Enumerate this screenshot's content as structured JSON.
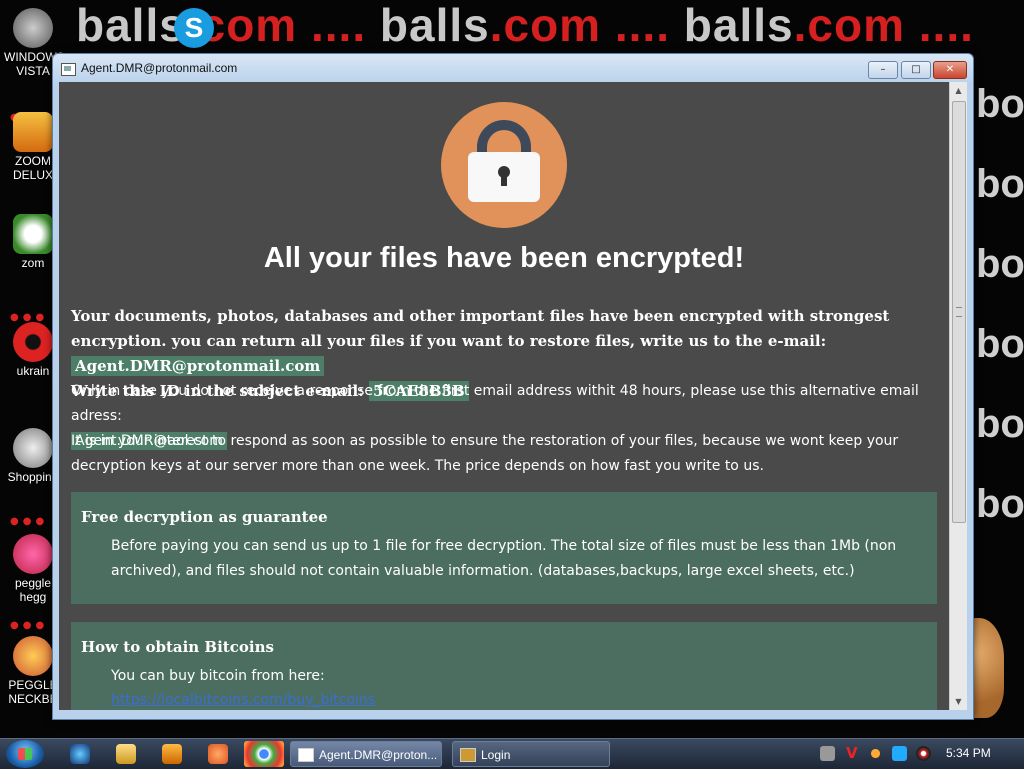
{
  "desktop": {
    "wallpaper_word": "balls",
    "wallpaper_tld": ".com",
    "wallpaper_dots": "....",
    "side_text": "bo",
    "icons": [
      {
        "label": "WINDOWS VISTA"
      },
      {
        "label": "ZOOM DELUX"
      },
      {
        "label": "zom"
      },
      {
        "label": "ukrain"
      },
      {
        "label": "Shopping"
      },
      {
        "label": "peggle hegg"
      },
      {
        "label": "PEGGLE NECKBE"
      }
    ]
  },
  "window": {
    "title": "Agent.DMR@protonmail.com",
    "min": "–",
    "max": "□",
    "close": "✕"
  },
  "note": {
    "headline": "All your files have been encrypted!",
    "p1_text": "Your documents, photos, databases and other important files have been encrypted with strongest encryption. you can return all your files if you want to restore files, write us to the e-mail:",
    "p1_email": "Agent.DMR@protonmail.com",
    "id_label": "Write this ID in the subject e-mail:",
    "id_value": "5CAE8B3B",
    "p2_text": "Only in case you do not receive a response from the first email address withit 48 hours, please use this alternative email adress:",
    "p2_email": "Agent.DMR@aol.com",
    "p3_text": "It is in your interest to respond as soon as possible to ensure the restoration of your files, because we wont keep your decryption keys at our server more than one week. The price depends on how fast you write to us.",
    "free_title": "Free decryption as guarantee",
    "free_text": "Before paying you can send us up to 1 file for free decryption. The total size of files must be less than 1Mb (non archived), and files should not contain valuable information. (databases,backups, large excel sheets, etc.)",
    "btc_title": "How to obtain Bitcoins",
    "btc_text": "You can buy bitcoin from here:",
    "btc_link": "https://localbitcoins.com/buy_bitcoins"
  },
  "taskbar": {
    "tasks": [
      {
        "label": "Agent.DMR@proton..."
      },
      {
        "label": "Login"
      }
    ],
    "clock": "5:34 PM"
  }
}
